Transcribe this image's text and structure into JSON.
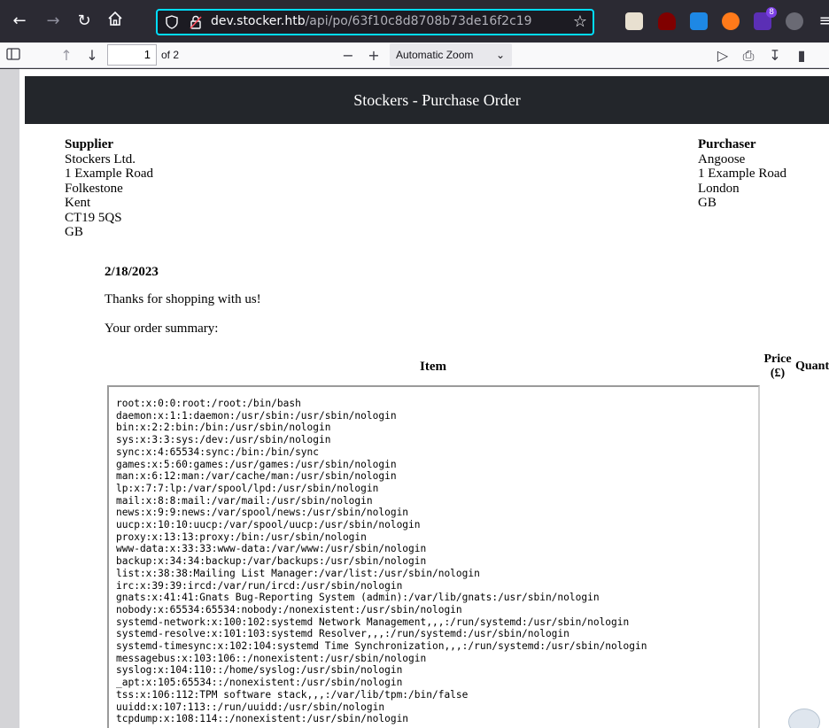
{
  "browser": {
    "url_host": "dev.stocker.htb",
    "url_path": "/api/po/63f10c8d8708b73de16f2c19",
    "extension_badge": "8"
  },
  "pdf_toolbar": {
    "page_number": "1",
    "page_count": "of 2",
    "zoom": "Automatic Zoom"
  },
  "document": {
    "title": "Stockers - Purchase Order",
    "supplier": {
      "heading": "Supplier",
      "lines": [
        "Stockers Ltd.",
        "1 Example Road",
        "Folkestone",
        "Kent",
        "CT19 5QS",
        "GB"
      ]
    },
    "purchaser": {
      "heading": "Purchaser",
      "lines": [
        "Angoose",
        "1 Example Road",
        "London",
        "GB"
      ]
    },
    "date": "2/18/2023",
    "thanks": "Thanks for shopping with us!",
    "summary_intro": "Your order summary:",
    "table_headers": {
      "item": "Item",
      "price_line1": "Price",
      "price_line2": "(£)",
      "quantity": "Quant"
    },
    "item_content": "root:x:0:0:root:/root:/bin/bash\ndaemon:x:1:1:daemon:/usr/sbin:/usr/sbin/nologin\nbin:x:2:2:bin:/bin:/usr/sbin/nologin\nsys:x:3:3:sys:/dev:/usr/sbin/nologin\nsync:x:4:65534:sync:/bin:/bin/sync\ngames:x:5:60:games:/usr/games:/usr/sbin/nologin\nman:x:6:12:man:/var/cache/man:/usr/sbin/nologin\nlp:x:7:7:lp:/var/spool/lpd:/usr/sbin/nologin\nmail:x:8:8:mail:/var/mail:/usr/sbin/nologin\nnews:x:9:9:news:/var/spool/news:/usr/sbin/nologin\nuucp:x:10:10:uucp:/var/spool/uucp:/usr/sbin/nologin\nproxy:x:13:13:proxy:/bin:/usr/sbin/nologin\nwww-data:x:33:33:www-data:/var/www:/usr/sbin/nologin\nbackup:x:34:34:backup:/var/backups:/usr/sbin/nologin\nlist:x:38:38:Mailing List Manager:/var/list:/usr/sbin/nologin\nirc:x:39:39:ircd:/var/run/ircd:/usr/sbin/nologin\ngnats:x:41:41:Gnats Bug-Reporting System (admin):/var/lib/gnats:/usr/sbin/nologin\nnobody:x:65534:65534:nobody:/nonexistent:/usr/sbin/nologin\nsystemd-network:x:100:102:systemd Network Management,,,:/run/systemd:/usr/sbin/nologin\nsystemd-resolve:x:101:103:systemd Resolver,,,:/run/systemd:/usr/sbin/nologin\nsystemd-timesync:x:102:104:systemd Time Synchronization,,,:/run/systemd:/usr/sbin/nologin\nmessagebus:x:103:106::/nonexistent:/usr/sbin/nologin\nsyslog:x:104:110::/home/syslog:/usr/sbin/nologin\n_apt:x:105:65534::/nonexistent:/usr/sbin/nologin\ntss:x:106:112:TPM software stack,,,:/var/lib/tpm:/bin/false\nuuidd:x:107:113::/run/uuidd:/usr/sbin/nologin\ntcpdump:x:108:114::/nonexistent:/usr/sbin/nologin"
  }
}
